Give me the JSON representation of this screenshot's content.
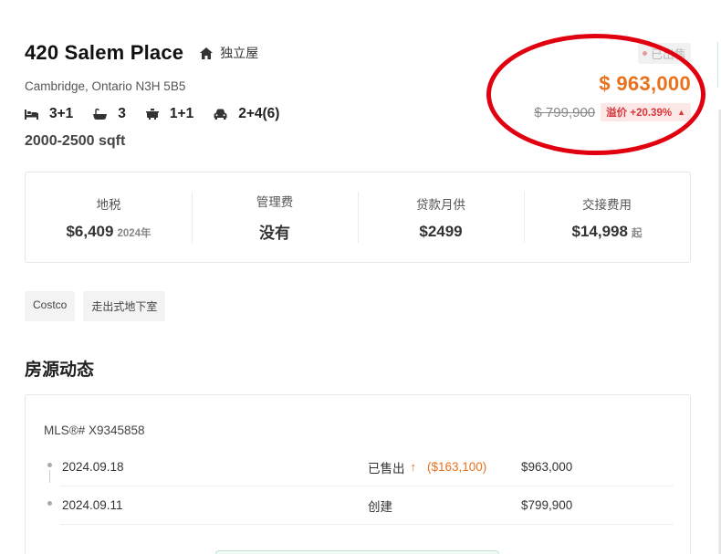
{
  "listing": {
    "title": "420 Salem Place",
    "property_type": "独立屋",
    "address": "Cambridge, Ontario N3H 5B5",
    "bedrooms": "3+1",
    "bathrooms": "3",
    "kitchens": "1+1",
    "parking": "2+4(6)",
    "sqft": "2000-2500 sqft"
  },
  "price": {
    "status": "已出售",
    "sold_price": "$ 963,000",
    "original_price": "$ 799,900",
    "premium_label": "溢价 +20.39%",
    "premium_arrow": "▲"
  },
  "stats": [
    {
      "label": "地税",
      "value": "$6,409",
      "suffix": "2024年"
    },
    {
      "label": "管理费",
      "value": "没有",
      "suffix": ""
    },
    {
      "label": "贷款月供",
      "value": "$2499",
      "suffix": ""
    },
    {
      "label": "交接费用",
      "value": "$14,998",
      "suffix": "起"
    }
  ],
  "tags": [
    "Costco",
    "走出式地下室"
  ],
  "history": {
    "section_title": "房源动态",
    "mls": "MLS®# X9345858",
    "rows": [
      {
        "date": "2024.09.18",
        "event": "已售出",
        "arrow": "↑",
        "diff": "($163,100)",
        "price": "$963,000"
      },
      {
        "date": "2024.09.11",
        "event": "创建",
        "arrow": "",
        "diff": "",
        "price": "$799,900"
      }
    ]
  },
  "icons": {
    "type_icon": "house-icon",
    "bed_icon": "bed-icon",
    "bath_icon": "bathtub-icon",
    "kitchen_icon": "kitchen-icon",
    "parking_icon": "car-icon"
  },
  "colors": {
    "accent_price": "#e9711c",
    "premium_red": "#d9353b",
    "annotation_ring": "#e1000f"
  }
}
